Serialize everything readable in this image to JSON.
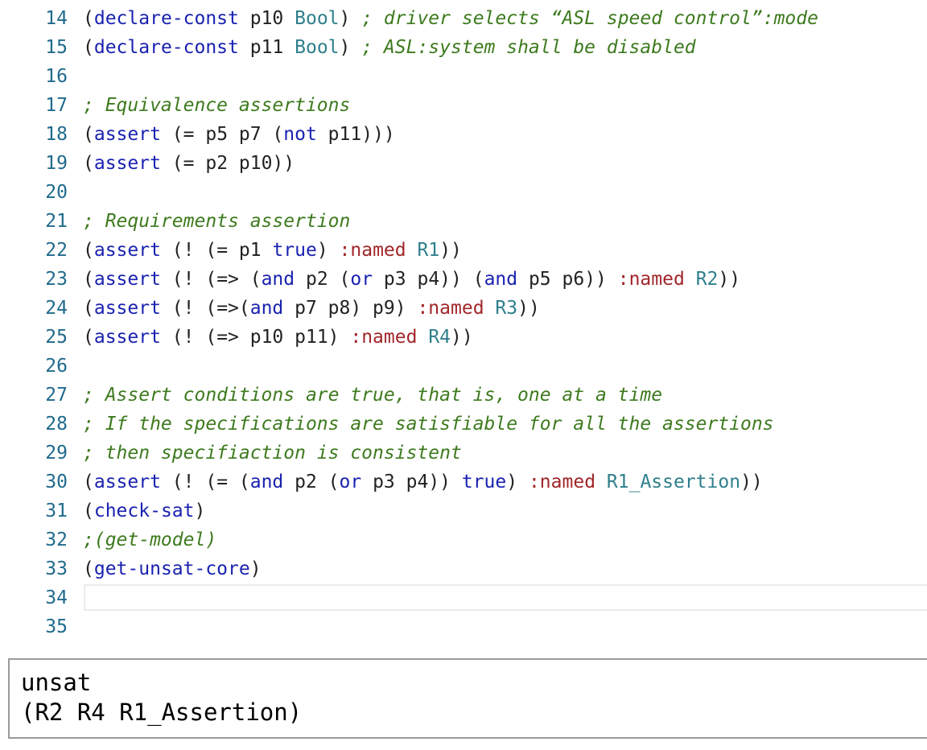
{
  "editor": {
    "lines": [
      {
        "n": "14",
        "tokens": [
          {
            "t": "(",
            "c": "paren"
          },
          {
            "t": "declare-const",
            "c": "kw"
          },
          {
            "t": " p10 ",
            "c": "var"
          },
          {
            "t": "Bool",
            "c": "type"
          },
          {
            "t": ") ",
            "c": "paren"
          },
          {
            "t": "; driver selects “ASL speed control”:mode",
            "c": "cmt"
          }
        ]
      },
      {
        "n": "15",
        "tokens": [
          {
            "t": "(",
            "c": "paren"
          },
          {
            "t": "declare-const",
            "c": "kw"
          },
          {
            "t": " p11 ",
            "c": "var"
          },
          {
            "t": "Bool",
            "c": "type"
          },
          {
            "t": ") ",
            "c": "paren"
          },
          {
            "t": "; ASL:system shall be disabled",
            "c": "cmt"
          }
        ]
      },
      {
        "n": "16",
        "tokens": []
      },
      {
        "n": "17",
        "tokens": [
          {
            "t": "; Equivalence assertions",
            "c": "cmt"
          }
        ]
      },
      {
        "n": "18",
        "tokens": [
          {
            "t": "(",
            "c": "paren"
          },
          {
            "t": "assert",
            "c": "kw"
          },
          {
            "t": " (= p5 p7 (",
            "c": "var"
          },
          {
            "t": "not",
            "c": "kw"
          },
          {
            "t": " p11)))",
            "c": "var"
          }
        ]
      },
      {
        "n": "19",
        "tokens": [
          {
            "t": "(",
            "c": "paren"
          },
          {
            "t": "assert",
            "c": "kw"
          },
          {
            "t": " (= p2 p10))",
            "c": "var"
          }
        ]
      },
      {
        "n": "20",
        "tokens": []
      },
      {
        "n": "21",
        "tokens": [
          {
            "t": "; Requirements assertion",
            "c": "cmt"
          }
        ]
      },
      {
        "n": "22",
        "tokens": [
          {
            "t": "(",
            "c": "paren"
          },
          {
            "t": "assert",
            "c": "kw"
          },
          {
            "t": " (! (= p1 ",
            "c": "var"
          },
          {
            "t": "true",
            "c": "bool"
          },
          {
            "t": ") ",
            "c": "var"
          },
          {
            "t": ":named",
            "c": "named"
          },
          {
            "t": " ",
            "c": "var"
          },
          {
            "t": "R1",
            "c": "label"
          },
          {
            "t": "))",
            "c": "var"
          }
        ]
      },
      {
        "n": "23",
        "tokens": [
          {
            "t": "(",
            "c": "paren"
          },
          {
            "t": "assert",
            "c": "kw"
          },
          {
            "t": " (! (=> (",
            "c": "var"
          },
          {
            "t": "and",
            "c": "kw"
          },
          {
            "t": " p2 (",
            "c": "var"
          },
          {
            "t": "or",
            "c": "kw"
          },
          {
            "t": " p3 p4)) (",
            "c": "var"
          },
          {
            "t": "and",
            "c": "kw"
          },
          {
            "t": " p5 p6)) ",
            "c": "var"
          },
          {
            "t": ":named",
            "c": "named"
          },
          {
            "t": " ",
            "c": "var"
          },
          {
            "t": "R2",
            "c": "label"
          },
          {
            "t": "))",
            "c": "var"
          }
        ]
      },
      {
        "n": "24",
        "tokens": [
          {
            "t": "(",
            "c": "paren"
          },
          {
            "t": "assert",
            "c": "kw"
          },
          {
            "t": " (! (=>(",
            "c": "var"
          },
          {
            "t": "and",
            "c": "kw"
          },
          {
            "t": " p7 p8) p9) ",
            "c": "var"
          },
          {
            "t": ":named",
            "c": "named"
          },
          {
            "t": " ",
            "c": "var"
          },
          {
            "t": "R3",
            "c": "label"
          },
          {
            "t": "))",
            "c": "var"
          }
        ]
      },
      {
        "n": "25",
        "tokens": [
          {
            "t": "(",
            "c": "paren"
          },
          {
            "t": "assert",
            "c": "kw"
          },
          {
            "t": " (! (=> p10 p11) ",
            "c": "var"
          },
          {
            "t": ":named",
            "c": "named"
          },
          {
            "t": " ",
            "c": "var"
          },
          {
            "t": "R4",
            "c": "label"
          },
          {
            "t": "))",
            "c": "var"
          }
        ]
      },
      {
        "n": "26",
        "tokens": []
      },
      {
        "n": "27",
        "tokens": [
          {
            "t": "; Assert conditions are true, that is, one at a time",
            "c": "cmt"
          }
        ]
      },
      {
        "n": "28",
        "tokens": [
          {
            "t": "; If the specifications are satisfiable for all the assertions",
            "c": "cmt"
          }
        ]
      },
      {
        "n": "29",
        "tokens": [
          {
            "t": "; then specifiaction is consistent",
            "c": "cmt"
          }
        ]
      },
      {
        "n": "30",
        "tokens": [
          {
            "t": "(",
            "c": "paren"
          },
          {
            "t": "assert",
            "c": "kw"
          },
          {
            "t": " (! (= (",
            "c": "var"
          },
          {
            "t": "and",
            "c": "kw"
          },
          {
            "t": " p2 (",
            "c": "var"
          },
          {
            "t": "or",
            "c": "kw"
          },
          {
            "t": " p3 p4)) ",
            "c": "var"
          },
          {
            "t": "true",
            "c": "bool"
          },
          {
            "t": ") ",
            "c": "var"
          },
          {
            "t": ":named",
            "c": "named"
          },
          {
            "t": " ",
            "c": "var"
          },
          {
            "t": "R1_Assertion",
            "c": "label"
          },
          {
            "t": "))",
            "c": "var"
          }
        ]
      },
      {
        "n": "31",
        "tokens": [
          {
            "t": "(",
            "c": "paren"
          },
          {
            "t": "check-sat",
            "c": "kw"
          },
          {
            "t": ")",
            "c": "paren"
          }
        ]
      },
      {
        "n": "32",
        "tokens": [
          {
            "t": ";(get-model)",
            "c": "cmt"
          }
        ]
      },
      {
        "n": "33",
        "tokens": [
          {
            "t": "(",
            "c": "paren"
          },
          {
            "t": "get-unsat-core",
            "c": "kw"
          },
          {
            "t": ")",
            "c": "paren"
          }
        ]
      },
      {
        "n": "34",
        "tokens": []
      },
      {
        "n": "35",
        "tokens": []
      }
    ],
    "colors": {
      "gutter": "#1f6a8c",
      "keyword": "#1a22b0",
      "type": "#2f7f8c",
      "comment": "#3d7a1e",
      "named": "#a1262a"
    }
  },
  "output": {
    "lines": [
      "unsat",
      "(R2 R4 R1_Assertion)"
    ]
  }
}
